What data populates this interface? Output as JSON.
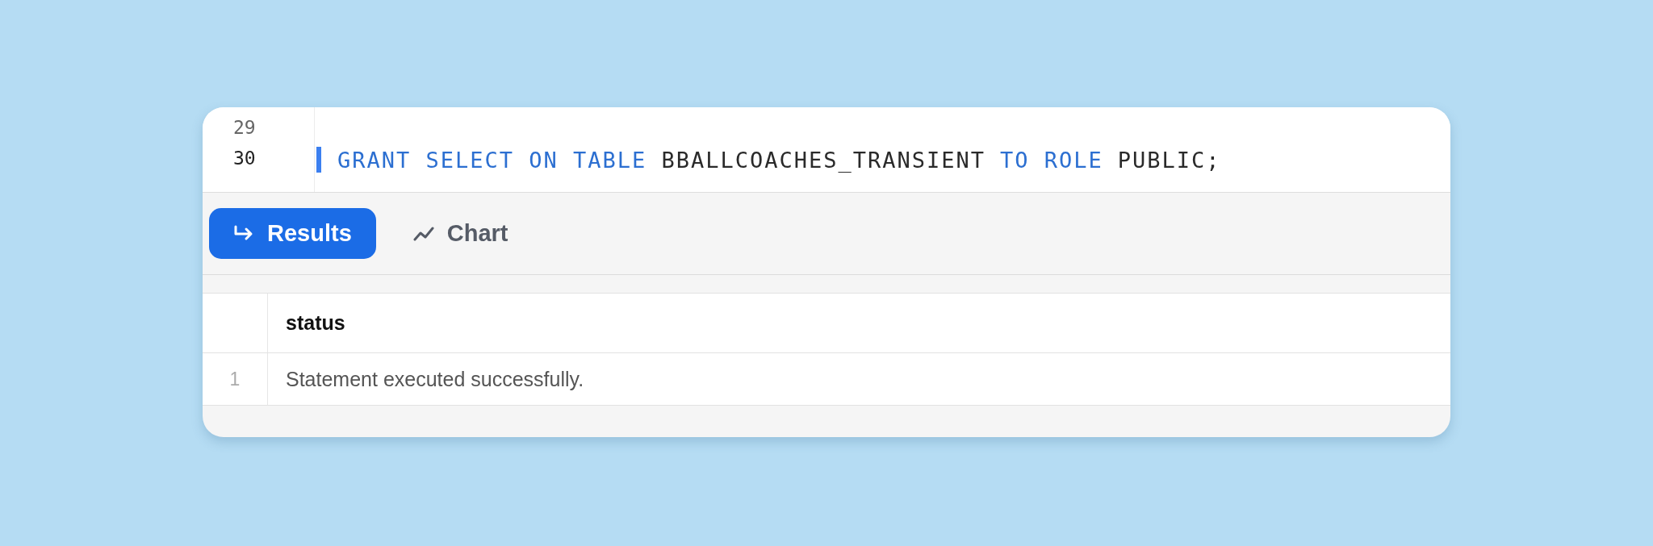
{
  "editor": {
    "lines": [
      {
        "number": "29",
        "active": false
      },
      {
        "number": "30",
        "active": true,
        "tokens": [
          {
            "text": "GRANT SELECT ON TABLE",
            "kind": "keyword"
          },
          {
            "text": "BBALLCOACHES_TRANSIENT",
            "kind": "identifier"
          },
          {
            "text": "TO ROLE",
            "kind": "keyword"
          },
          {
            "text": "PUBLIC;",
            "kind": "identifier"
          }
        ]
      }
    ]
  },
  "tabs": [
    {
      "label": "Results",
      "selected": true
    },
    {
      "label": "Chart",
      "selected": false
    }
  ],
  "table": {
    "columns": [
      "status"
    ],
    "rows": [
      {
        "index": "1",
        "cells": [
          "Statement executed successfully."
        ]
      }
    ]
  }
}
